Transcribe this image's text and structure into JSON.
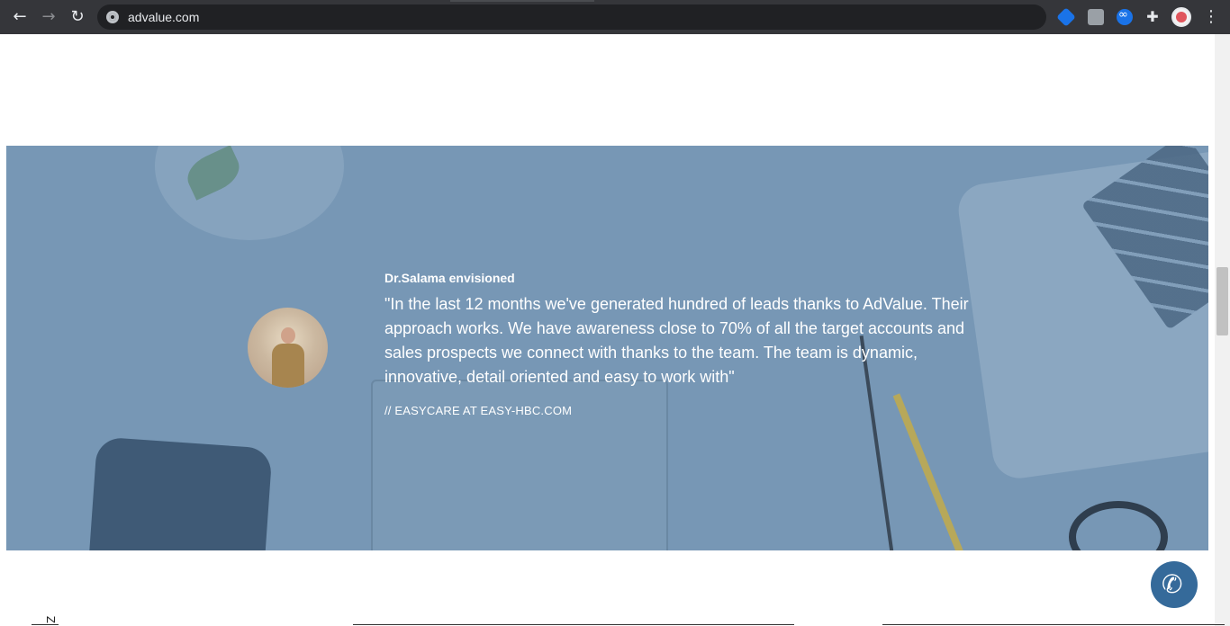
{
  "browser": {
    "url": "advalue.com",
    "back_icon": "arrow-left-icon",
    "forward_icon": "arrow-right-icon",
    "reload_icon": "reload-icon",
    "back_glyph": "←",
    "forward_glyph": "→",
    "reload_glyph": "↻",
    "menu_glyph": "⋮",
    "puzzle_glyph": "✚"
  },
  "testimonial": {
    "author": "Dr.Salama envisioned",
    "quote": "\"In the last 12 months we've generated hundred of leads thanks to AdValue. Their approach works. We have awareness close to 70% of all the target accounts and sales prospects we connect with thanks to the team. The team is dynamic, innovative, detail oriented and easy to work with\"",
    "company": "// EASYCARE AT EASY-HBC.COM"
  },
  "call_button": {
    "glyph": "✆"
  },
  "footer": {
    "partial_text": "Z"
  },
  "colors": {
    "hero_overlay": "#7797b5",
    "call_button": "#356a9a",
    "chrome": "#35363a"
  }
}
